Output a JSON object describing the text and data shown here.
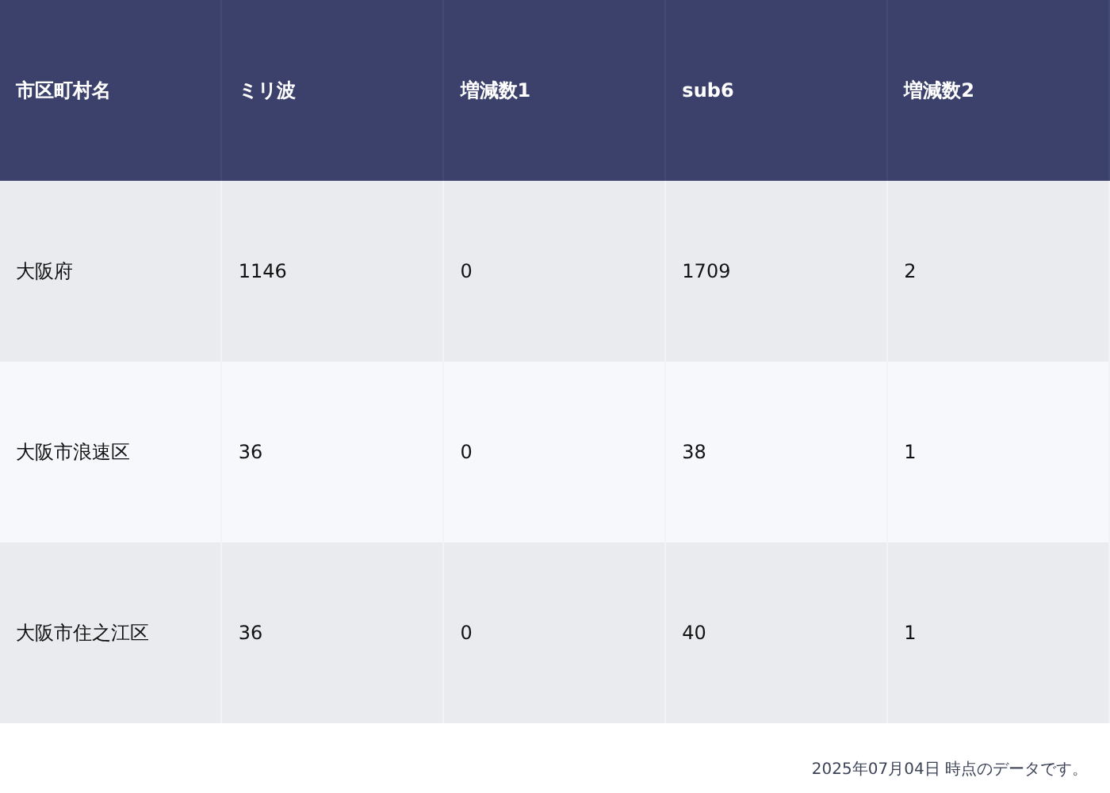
{
  "table": {
    "columns": [
      "市区町村名",
      "ミリ波",
      "増減数1",
      "sub6",
      "増減数2"
    ],
    "rows": [
      [
        "大阪府",
        "1146",
        "0",
        "1709",
        "2"
      ],
      [
        "大阪市浪速区",
        "36",
        "0",
        "38",
        "1"
      ],
      [
        "大阪市住之江区",
        "36",
        "0",
        "40",
        "1"
      ]
    ]
  },
  "footnote": "2025年07月04日 時点のデータです。"
}
